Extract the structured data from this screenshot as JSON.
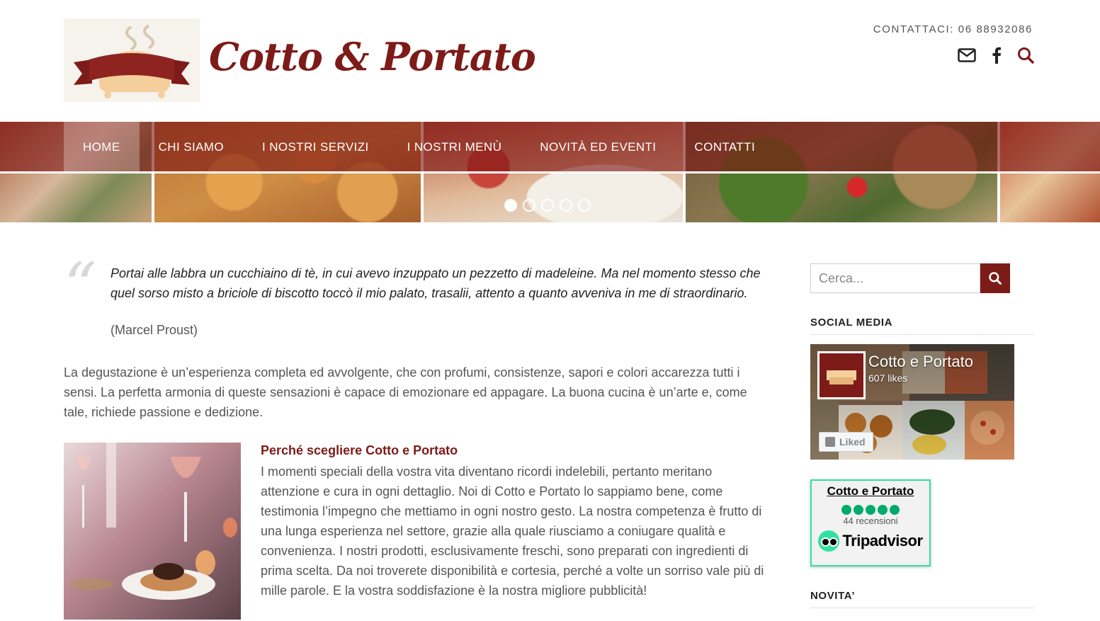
{
  "header": {
    "logo_text": "Cotto & Portato",
    "contact": "CONTATTACI: 06 88932086",
    "icons": [
      "envelope-icon",
      "facebook-icon",
      "search-icon"
    ]
  },
  "nav": {
    "items": [
      {
        "label": "HOME",
        "active": true
      },
      {
        "label": "CHI SIAMO",
        "active": false
      },
      {
        "label": "I NOSTRI SERVIZI",
        "active": false
      },
      {
        "label": "I NOSTRI MENÙ",
        "active": false
      },
      {
        "label": "NOVITÀ ED EVENTI",
        "active": false
      },
      {
        "label": "CONTATTI",
        "active": false
      }
    ],
    "slider_dots": 5,
    "slider_active": 1
  },
  "main": {
    "quote": "Portai alle labbra un cucchiaino di tè, in cui avevo inzuppato un pezzetto di madeleine. Ma nel momento stesso che quel sorso misto a briciole di biscotto toccò il mio palato, trasalii, attento a quanto avveniva in me di straordinario.",
    "quote_author": "(Marcel Proust)",
    "intro": "La degustazione è un’esperienza completa ed avvolgente, che con profumi, consistenze, sapori e colori accarezza tutti i sensi. La perfetta armonia di queste sensazioni è capace di emozionare ed appagare. La buona cucina è un’arte e, come tale, richiede passione e dedizione.",
    "why_title": "Perché scegliere Cotto e Portato",
    "why_text": "I momenti speciali della vostra vita diventano ricordi indelebili, pertanto meritano attenzione e cura in ogni dettaglio. Noi di Cotto e Portato lo sappiamo bene, come testimonia l’impegno che mettiamo in ogni nostro gesto. La nostra competenza è frutto di una lunga esperienza nel settore, grazie alla quale riusciamo a coniugare qualità e convenienza. I nostri prodotti, esclusivamente freschi, sono preparati con ingredienti di prima scelta. Da noi troverete disponibilità e cortesia, perché a volte un sorriso vale più di mille parole. E la vostra soddisfazione è la nostra migliore pubblicità!"
  },
  "sidebar": {
    "search_placeholder": "Cerca...",
    "social_title": "SOCIAL MEDIA",
    "fb_name": "Cotto e Portato",
    "fb_likes": "607 likes",
    "fb_liked": "Liked",
    "ta_name": "Cotto e Portato",
    "ta_rating": 5,
    "ta_reviews": "44 recensioni",
    "ta_logo": "Tripadvisor",
    "news_title": "NOVITA’"
  },
  "colors": {
    "brand": "#7d1b18",
    "tripadvisor": "#34e0a1"
  }
}
